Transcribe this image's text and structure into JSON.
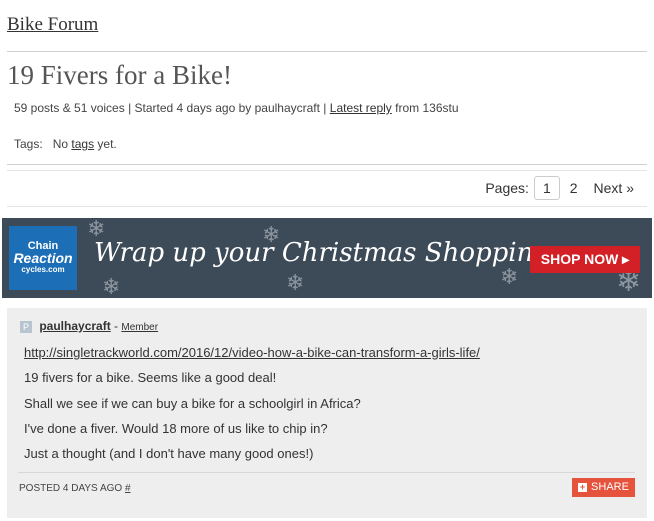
{
  "breadcrumb": "Bike Forum",
  "topic": {
    "title": "19 Fivers for a Bike!",
    "meta_prefix": "59 posts & 51 voices | Started 4 days ago by paulhaycraft |",
    "latest_reply": "Latest reply",
    "meta_suffix": "from 136stu"
  },
  "tags": {
    "label": "Tags:",
    "prefix": "No",
    "link": "tags",
    "suffix": "yet."
  },
  "pagination": {
    "label": "Pages:",
    "current": "1",
    "page2": "2",
    "next": "Next »"
  },
  "banner": {
    "logo_top": "Chain",
    "logo_mid": "Reaction",
    "logo_bottom": "cycles.com",
    "headline": "Wrap up your Christmas Shopping",
    "cta": "SHOP NOW ▸",
    "bg_color": "#3d4a57",
    "cta_color": "#d32026"
  },
  "post": {
    "author": "paulhaycraft",
    "separator": "-",
    "role": "Member",
    "avatar_letter": "P",
    "link": "http://singletrackworld.com/2016/12/video-how-a-bike-can-transform-a-girls-life/",
    "lines": [
      "19 fivers for a bike. Seems like a good deal!",
      "Shall we see if we can buy a bike for a schoolgirl in Africa?",
      "I've done a fiver. Would 18 more of us like to chip in?",
      "Just a thought (and I don't have many good ones!)"
    ],
    "posted": "POSTED 4 DAYS AGO",
    "permalink": "#",
    "share": "SHARE",
    "share_color": "#e5533d"
  }
}
